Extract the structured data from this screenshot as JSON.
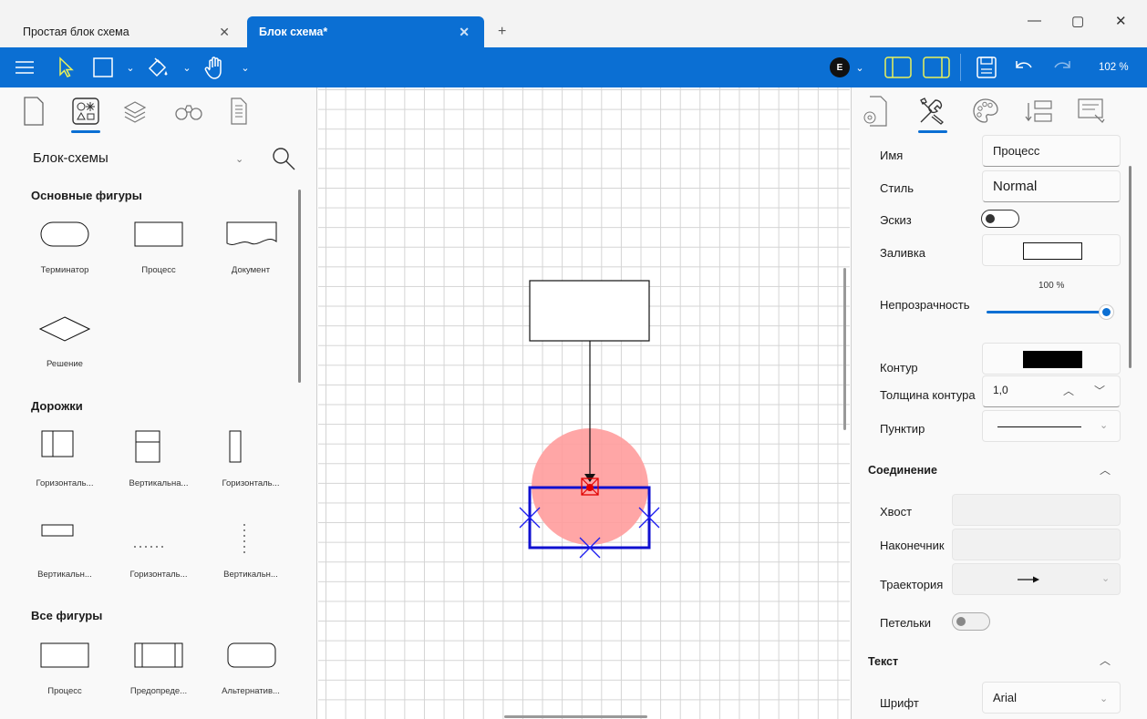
{
  "tabs": [
    {
      "label": "Простая блок схема"
    },
    {
      "label": "Блок схема*"
    }
  ],
  "toolbar": {
    "zoom": "102 %",
    "theme_badge": "E",
    "icons": [
      "menu-icon",
      "select-arrow-icon",
      "rectangle-tool-icon",
      "fill-bucket-icon",
      "hand-pan-icon",
      "theme-circle-icon",
      "left-panel-toggle-icon",
      "right-panel-toggle-icon",
      "save-icon",
      "undo-icon",
      "redo-icon"
    ]
  },
  "left_panel": {
    "category": "Блок-схемы",
    "sections": [
      {
        "title": "Основные фигуры",
        "items": [
          "Терминатор",
          "Процесс",
          "Документ",
          "Решение"
        ]
      },
      {
        "title": "Дорожки",
        "items": [
          "Горизонталь...",
          "Вертикальна...",
          "Горизонталь...",
          "Вертикальн...",
          "Горизонталь...",
          "Вертикальн..."
        ]
      },
      {
        "title": "Все фигуры",
        "items": [
          "Процесс",
          "Предопреде...",
          "Альтернатив..."
        ]
      }
    ]
  },
  "properties": {
    "name_label": "Имя",
    "name_value": "Процесс",
    "style_label": "Стиль",
    "style_value": "Normal",
    "sketch_label": "Эскиз",
    "fill_label": "Заливка",
    "fill_color": "#ffffff",
    "opacity_label": "Непрозрачность",
    "opacity_value": "100 %",
    "opacity_level": 1.0,
    "outline_label": "Контур",
    "outline_color": "#000000",
    "thickness_label": "Толщина контура",
    "thickness_value": "1,0",
    "dash_label": "Пунктир",
    "connection_title": "Соединение",
    "tail_label": "Хвост",
    "head_label": "Наконечник",
    "path_label": "Траектория",
    "loops_label": "Петельки",
    "text_title": "Текст",
    "font_label": "Шрифт",
    "font_value": "Arial"
  },
  "colors": {
    "accent": "#0b6fd3",
    "selection": "#1010d0",
    "highlight_circle": "#ff9c9c",
    "anchor": "#e00000"
  }
}
